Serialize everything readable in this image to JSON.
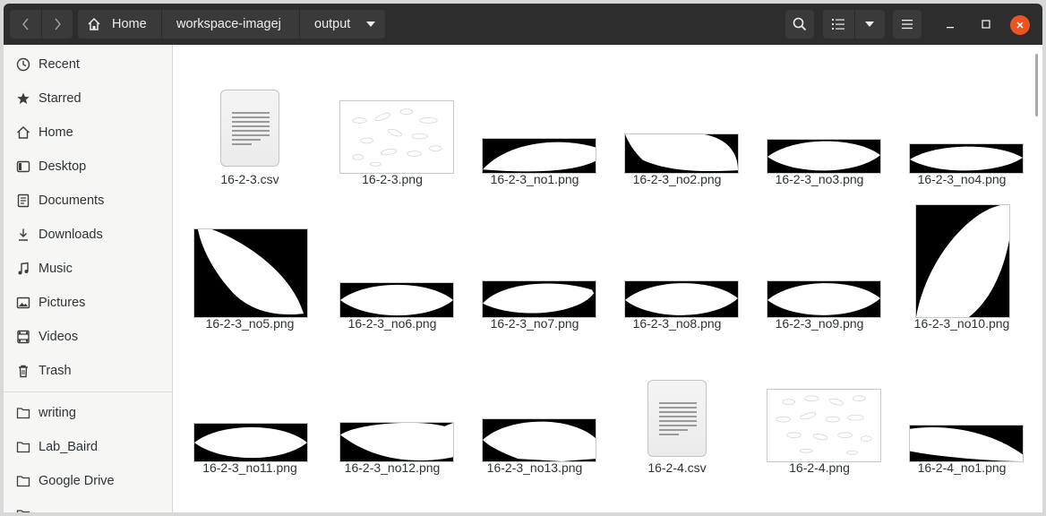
{
  "header": {
    "back_icon": "chevron-left-icon",
    "forward_icon": "chevron-right-icon",
    "breadcrumbs": [
      "Home",
      "workspace-imagej",
      "output"
    ]
  },
  "sidebar": {
    "items": [
      {
        "label": "Recent",
        "icon": "clock-icon"
      },
      {
        "label": "Starred",
        "icon": "star-icon"
      },
      {
        "label": "Home",
        "icon": "home-icon"
      },
      {
        "label": "Desktop",
        "icon": "desktop-icon"
      },
      {
        "label": "Documents",
        "icon": "document-icon"
      },
      {
        "label": "Downloads",
        "icon": "download-icon"
      },
      {
        "label": "Music",
        "icon": "music-icon"
      },
      {
        "label": "Pictures",
        "icon": "picture-icon"
      },
      {
        "label": "Videos",
        "icon": "video-icon"
      },
      {
        "label": "Trash",
        "icon": "trash-icon"
      }
    ],
    "bookmarks": [
      {
        "label": "writing",
        "icon": "folder-icon"
      },
      {
        "label": "Lab_Baird",
        "icon": "folder-icon"
      },
      {
        "label": "Google Drive",
        "icon": "folder-icon"
      }
    ]
  },
  "files": [
    {
      "name": "16-2-3.csv",
      "kind": "csv"
    },
    {
      "name": "16-2-3.png",
      "kind": "overview"
    },
    {
      "name": "16-2-3_no1.png",
      "kind": "mask"
    },
    {
      "name": "16-2-3_no2.png",
      "kind": "mask"
    },
    {
      "name": "16-2-3_no3.png",
      "kind": "mask"
    },
    {
      "name": "16-2-3_no4.png",
      "kind": "mask"
    },
    {
      "name": "16-2-3_no5.png",
      "kind": "mask"
    },
    {
      "name": "16-2-3_no6.png",
      "kind": "mask"
    },
    {
      "name": "16-2-3_no7.png",
      "kind": "mask"
    },
    {
      "name": "16-2-3_no8.png",
      "kind": "mask"
    },
    {
      "name": "16-2-3_no9.png",
      "kind": "mask"
    },
    {
      "name": "16-2-3_no10.png",
      "kind": "mask"
    },
    {
      "name": "16-2-3_no11.png",
      "kind": "mask"
    },
    {
      "name": "16-2-3_no12.png",
      "kind": "mask"
    },
    {
      "name": "16-2-3_no13.png",
      "kind": "mask"
    },
    {
      "name": "16-2-4.csv",
      "kind": "csv"
    },
    {
      "name": "16-2-4.png",
      "kind": "overview"
    },
    {
      "name": "16-2-4_no1.png",
      "kind": "mask"
    }
  ],
  "colors": {
    "headerbar": "#2d2d2d",
    "close_button": "#e95420",
    "sidebar_bg": "#f6f6f5"
  }
}
